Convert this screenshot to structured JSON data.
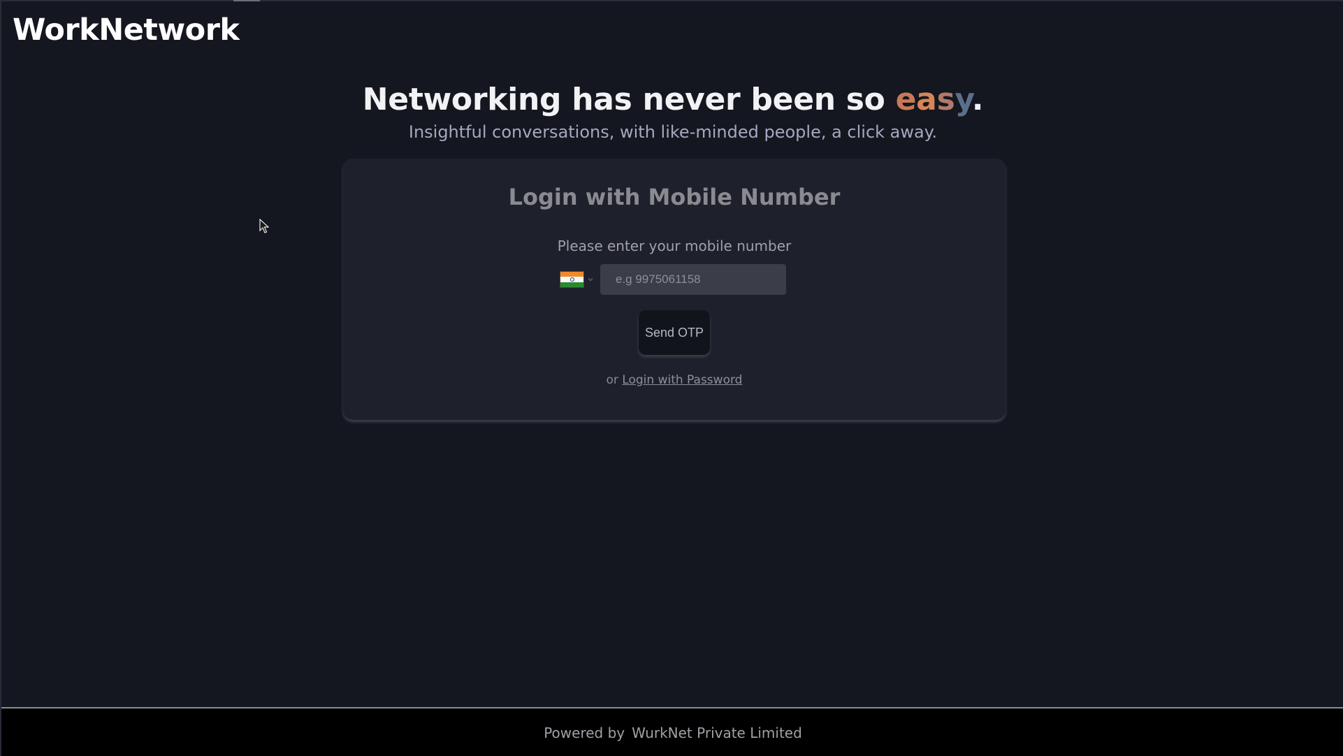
{
  "header": {
    "brand": "WorkNetwork"
  },
  "hero": {
    "title_prefix": "Networking has never been so ",
    "title_highlight": [
      "e",
      "a",
      "s",
      "y"
    ],
    "title_suffix": ".",
    "subtitle": "Insightful conversations, with like-minded people, a click away."
  },
  "login_card": {
    "title": "Login with Mobile Number",
    "prompt": "Please enter your mobile number",
    "country": {
      "selected_flag": "india-flag-icon",
      "colors": {
        "saffron": "#f08a2a",
        "white": "#f7f7f7",
        "green": "#2a8a2e"
      }
    },
    "phone_input": {
      "value": "",
      "placeholder": "e.g 9975061158"
    },
    "send_otp_label": "Send OTP",
    "alt_prefix": "or",
    "alt_link_label": "Login with Password"
  },
  "footer": {
    "powered_by": "Powered by",
    "company": "WurkNet Private Limited"
  },
  "colors": {
    "background": "#141620",
    "card": "#1e202b",
    "accent_easy": "#d88456",
    "footer_bg": "#000000"
  }
}
